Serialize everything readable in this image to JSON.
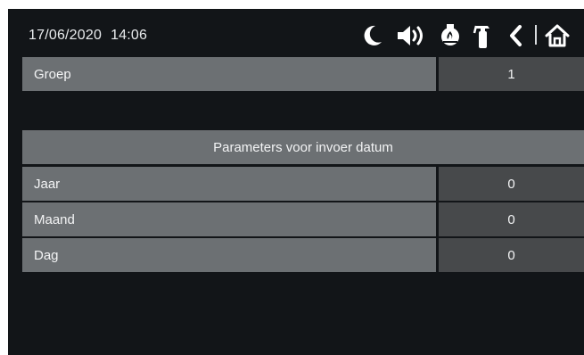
{
  "status_bar": {
    "date": "17/06/2020",
    "time": "14:06",
    "icons": [
      "moon-icon",
      "speaker-icon",
      "fire-alarm-icon",
      "fire-extinguisher-icon",
      "back-icon",
      "home-icon"
    ]
  },
  "group_row": {
    "label": "Groep",
    "value": "1"
  },
  "section": {
    "title": "Parameters voor invoer datum"
  },
  "params": [
    {
      "label": "Jaar",
      "value": "0"
    },
    {
      "label": "Maand",
      "value": "0"
    },
    {
      "label": "Dag",
      "value": "0"
    }
  ],
  "colors": {
    "background": "#121518",
    "label_cell": "#6c7073",
    "value_cell": "#47494b",
    "text": "#f3f4f5"
  }
}
